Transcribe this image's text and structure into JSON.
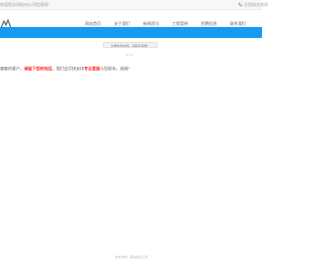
{
  "topbar": {
    "welcome": "欢迎您访问杭州公司信息网！",
    "hotline": "全国服务热线",
    "icons": {
      "phone": "phone-icon"
    }
  },
  "header": {
    "logo": {
      "text": ""
    },
    "nav": [
      {
        "label": "网站首页"
      },
      {
        "label": "关于我们"
      },
      {
        "label": "新闻资讯"
      },
      {
        "label": "工程案例"
      },
      {
        "label": "招聘信息"
      },
      {
        "label": "联系我们"
      }
    ]
  },
  "main": {
    "notice_button": "您要找的内容，请联系客服！",
    "page_indicator": "1 / 1",
    "content": {
      "prefix": "尊敬的客户，",
      "highlight1": "请留下您的电话",
      "middle": "，我们会尽快安排",
      "highlight2": "专业客服",
      "suffix": "与您联系，谢谢！"
    }
  },
  "footer": {
    "text": "技术支持：网站建设公司"
  },
  "colors": {
    "banner": "#179bf0",
    "highlight": "#ff2a2a",
    "topbar_bg": "#f7f7f7"
  }
}
